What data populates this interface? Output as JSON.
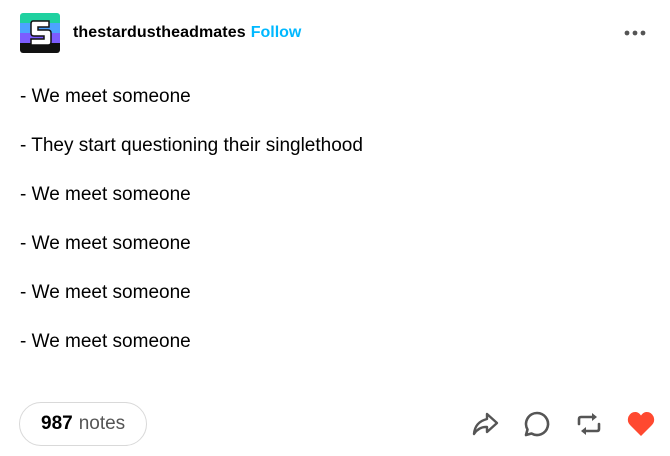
{
  "post": {
    "blog_name": "thestardustheadmates",
    "follow_label": "Follow",
    "more_icon": "more-horizontal-icon",
    "lines": [
      "- We meet someone",
      "- They start questioning their singlethood",
      "- We meet someone",
      "- We meet someone",
      "- We meet someone",
      "- We meet someone"
    ]
  },
  "footer": {
    "notes_count": "987",
    "notes_label": "notes",
    "actions": [
      "share-icon",
      "reply-icon",
      "reblog-icon",
      "like-heart-icon"
    ]
  },
  "colors": {
    "follow": "#00b8ff",
    "heart": "#ff4930",
    "notes_border": "#d9d9d9",
    "avatar_top": "#7c5cff",
    "avatar_mid": "#4da3ff",
    "avatar_bottom": "#3a2b8c"
  }
}
